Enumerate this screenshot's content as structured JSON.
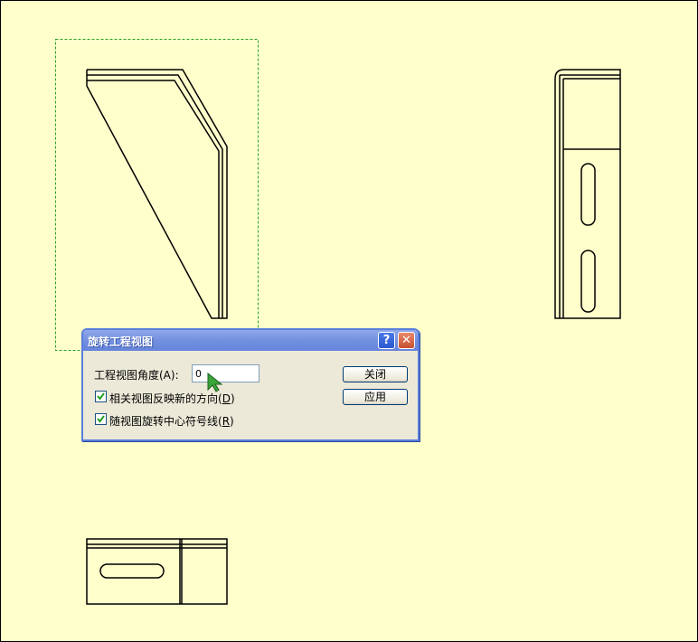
{
  "dialog": {
    "title": "旋转工程视图",
    "help_glyph": "?",
    "close_glyph": "✕",
    "angle_label_text": "工程视图角度(A):",
    "angle_value": "0",
    "reflect_label": "相关视图反映新的方向(",
    "reflect_key": "D",
    "reflect_end": ")",
    "reflect_checked": true,
    "rotate_label": "随视图旋转中心符号线(",
    "rotate_key": "R",
    "rotate_end": ")",
    "rotate_checked": true,
    "close_button": "关闭",
    "apply_button": "应用"
  },
  "colors": {
    "sheet_background": "#ffffcc",
    "selection_border": "#2ca02c",
    "dialog_accent": "#5a7edc",
    "cursor_fill": "#3aa63a"
  },
  "icons": {
    "help": "help-icon",
    "close": "close-icon",
    "check": "checkmark-icon",
    "cursor": "arrow-cursor-icon"
  }
}
